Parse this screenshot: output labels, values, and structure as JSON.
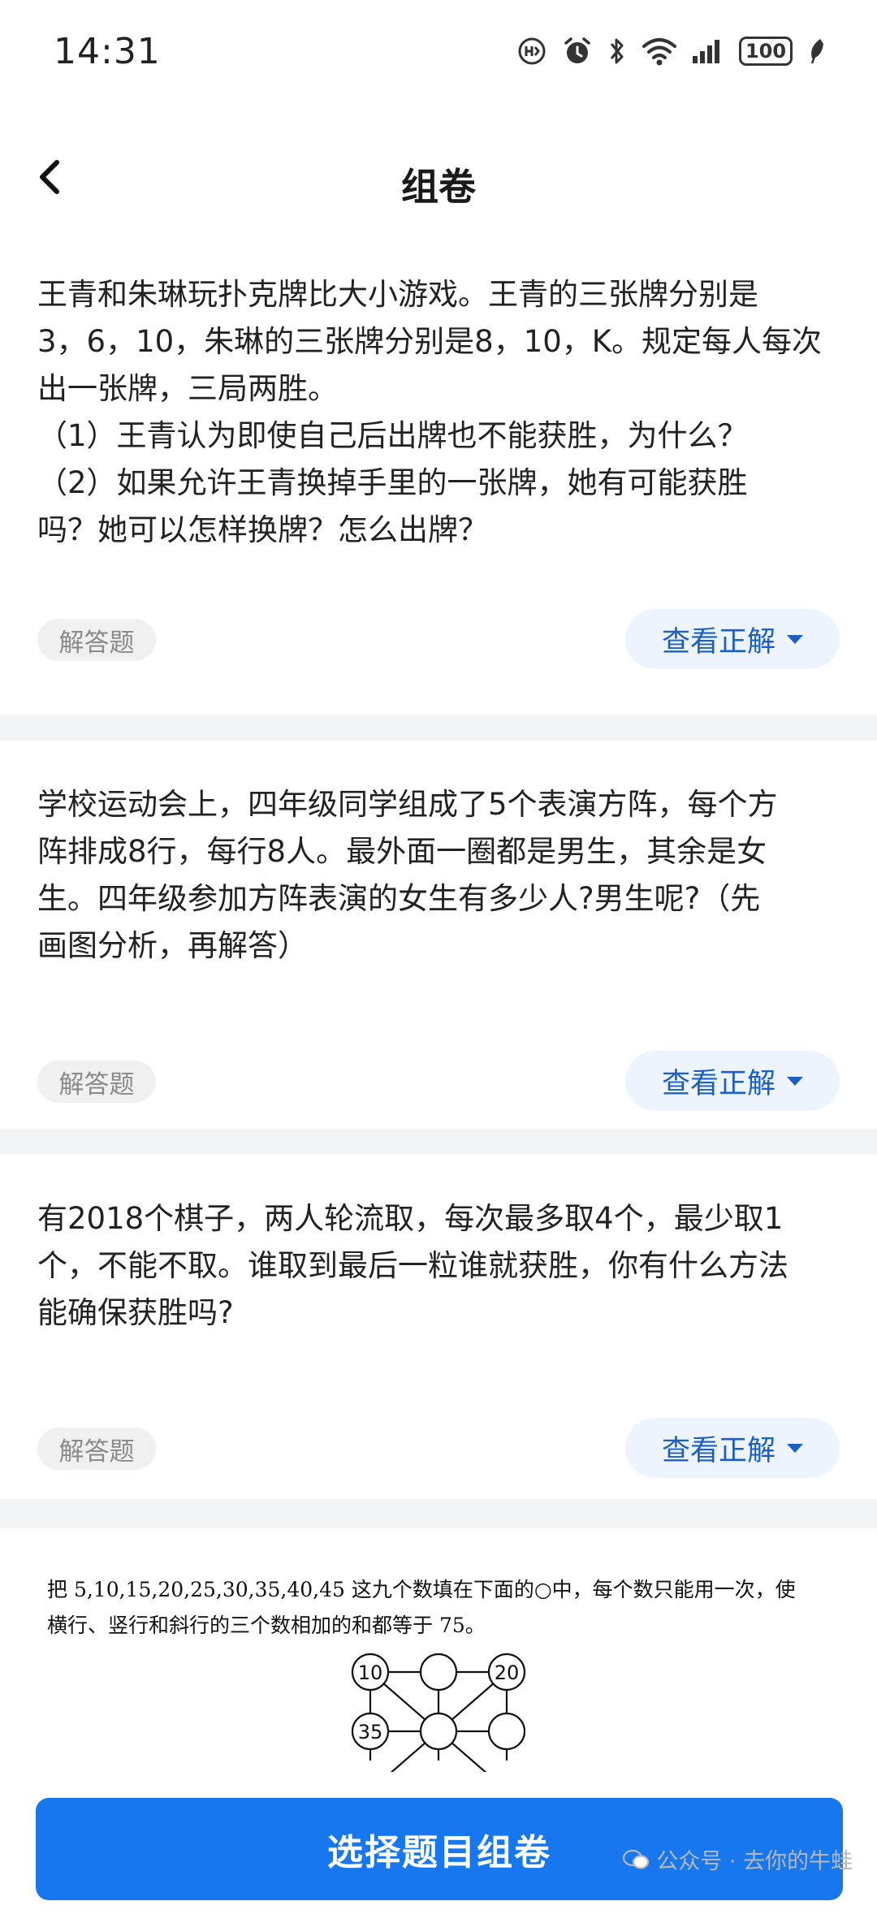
{
  "status_bar": {
    "time": "14:31",
    "battery": "100"
  },
  "header": {
    "title": "组卷"
  },
  "questions": [
    {
      "lines": [
        "王青和朱琳玩扑克牌比大小游戏。王青的三张牌分别是",
        "3，6，10，朱琳的三张牌分别是8，10，K。规定每人每次",
        "出一张牌，三局两胜。",
        "（1）王青认为即使自己后出牌也不能获胜，为什么？",
        "（2）如果允许王青换掉手里的一张牌，她有可能获胜",
        "吗？她可以怎样换牌？怎么出牌？"
      ],
      "type": "解答题",
      "answer_label": "查看正解"
    },
    {
      "lines": [
        "学校运动会上，四年级同学组成了5个表演方阵，每个方",
        "阵排成8行，每行8人。最外面一圈都是男生，其余是女",
        "生。四年级参加方阵表演的女生有多少人?男生呢?（先",
        "画图分析，再解答）"
      ],
      "type": "解答题",
      "answer_label": "查看正解"
    },
    {
      "lines": [
        "有2018个棋子，两人轮流取，每次最多取4个，最少取1",
        "个，不能不取。谁取到最后一粒谁就获胜，你有什么方法",
        "能确保获胜吗?"
      ],
      "type": "解答题",
      "answer_label": "查看正解"
    }
  ],
  "image_question": {
    "lines": [
      "把 5,10,15,20,25,30,35,40,45 这九个数填在下面的○中，每个数只能用一次，使",
      "横行、竖行和斜行的三个数相加的和都等于 75。"
    ],
    "circles": [
      "10",
      "",
      "20",
      "35",
      "",
      ""
    ]
  },
  "bottom": {
    "button_label": "选择题目组卷"
  },
  "watermark": {
    "text": "公众号 · 去你的牛蛙"
  },
  "colors": {
    "accent": "#1677ee",
    "answer_text": "#1b5fc6",
    "answer_bg": "#eef4fd",
    "tag_bg": "#f0f0f0",
    "page_bg": "#f3f4f6"
  }
}
